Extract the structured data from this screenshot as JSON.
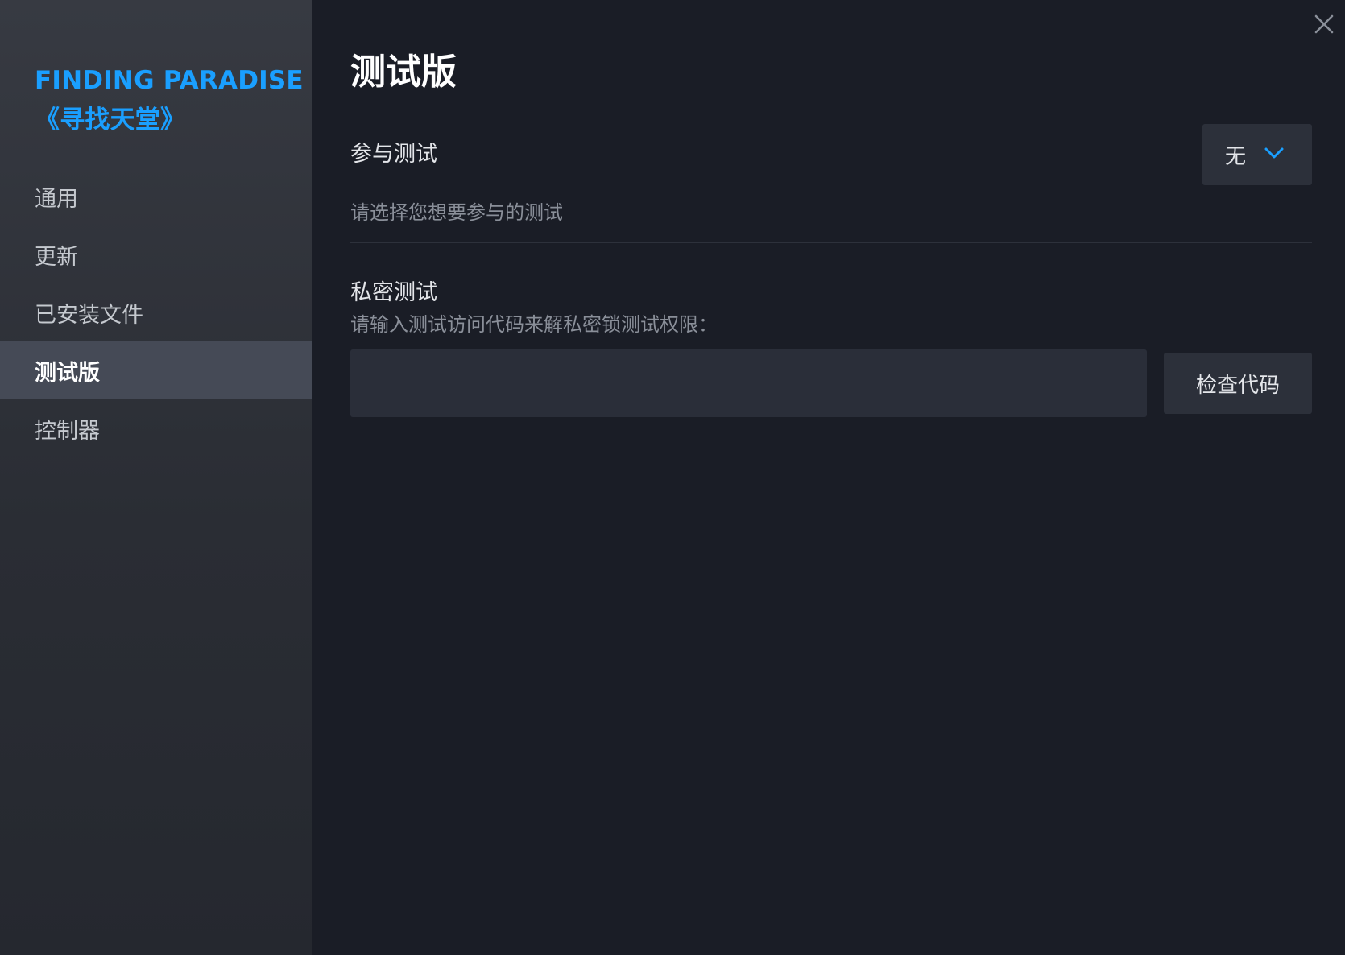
{
  "sidebar": {
    "game_title_line1": "FINDING PARADISE",
    "game_title_line2": "《寻找天堂》",
    "items": [
      {
        "label": "通用",
        "active": false
      },
      {
        "label": "更新",
        "active": false
      },
      {
        "label": "已安装文件",
        "active": false
      },
      {
        "label": "测试版",
        "active": true
      },
      {
        "label": "控制器",
        "active": false
      }
    ]
  },
  "main": {
    "title": "测试版",
    "participate": {
      "label": "参与测试",
      "description": "请选择您想要参与的测试",
      "dropdown_value": "无"
    },
    "private_beta": {
      "label": "私密测试",
      "description": "请输入测试访问代码来解私密锁测试权限：",
      "input_value": "",
      "button_label": "检查代码"
    }
  },
  "icons": {
    "close": "close-icon",
    "dropdown": "chevron-down-icon"
  },
  "colors": {
    "accent": "#1a9fff",
    "sidebar_bg": "#2f323a",
    "main_bg": "#1a1d26",
    "active_item_bg": "#454a56"
  }
}
